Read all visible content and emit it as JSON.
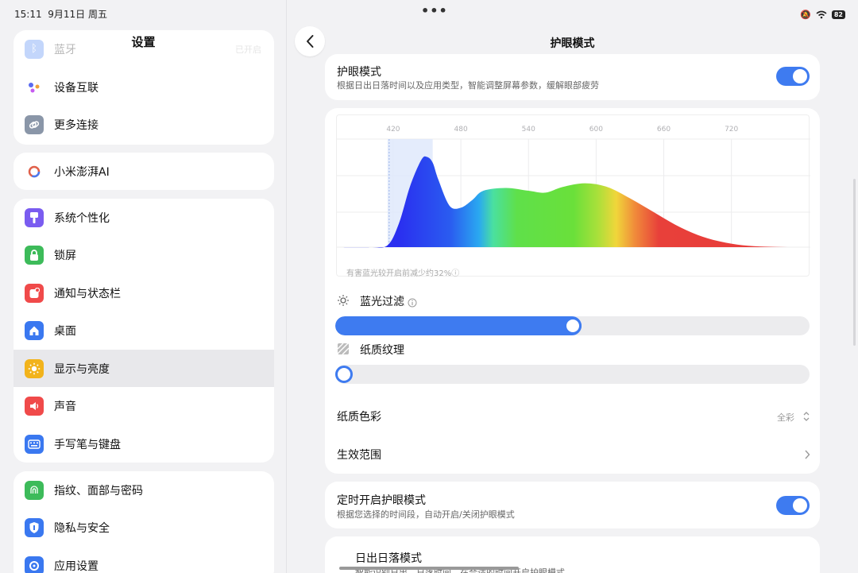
{
  "status": {
    "time": "15:11",
    "date": "9月11日 周五",
    "dots": "•••",
    "battery": "82"
  },
  "left": {
    "title": "设置",
    "bluetooth": {
      "label": "蓝牙",
      "value": "已开启"
    },
    "group1": [
      {
        "label": "设备互联",
        "icon": "device-link-icon"
      },
      {
        "label": "更多连接",
        "icon": "link-icon"
      }
    ],
    "ai": {
      "label": "小米澎湃AI",
      "icon": "hyperos-ai-icon"
    },
    "group2": [
      {
        "label": "系统个性化",
        "icon": "brush-icon",
        "color": "#7a5cf0"
      },
      {
        "label": "锁屏",
        "icon": "lock-icon",
        "color": "#3dbb5a"
      },
      {
        "label": "通知与状态栏",
        "icon": "notification-icon",
        "color": "#f04a4a"
      },
      {
        "label": "桌面",
        "icon": "home-icon",
        "color": "#3a78f0"
      },
      {
        "label": "显示与亮度",
        "icon": "sun-icon",
        "color": "#f2b31b"
      },
      {
        "label": "声音",
        "icon": "speaker-icon",
        "color": "#f04a4a"
      },
      {
        "label": "手写笔与键盘",
        "icon": "keyboard-icon",
        "color": "#3a78f0"
      }
    ],
    "group3": [
      {
        "label": "指纹、面部与密码",
        "icon": "fingerprint-icon",
        "color": "#3dbb5a"
      },
      {
        "label": "隐私与安全",
        "icon": "shield-icon",
        "color": "#3a78f0"
      },
      {
        "label": "应用设置",
        "icon": "app-settings-icon",
        "color": "#3a78f0"
      }
    ]
  },
  "right": {
    "title": "护眼模式",
    "eye_mode": {
      "title": "护眼模式",
      "subtitle": "根据日出日落时间以及应用类型，智能调整屏幕参数，缓解眼部疲劳"
    },
    "chart_note": "有害蓝光较开启前减少约32%ⓘ",
    "blue_filter": {
      "label": "蓝光过滤",
      "level": 0.5
    },
    "paper_texture": {
      "label": "纸质纹理",
      "level": 0.0
    },
    "paper_color": {
      "label": "纸质色彩",
      "value": "全彩"
    },
    "scope": {
      "label": "生效范围"
    },
    "timer": {
      "title": "定时开启护眼模式",
      "subtitle": "根据您选择的时间段，自动开启/关闭护眼模式"
    },
    "sunrise": {
      "title": "日出日落模式",
      "subtitle": "智能识别日出、日落时间，在合适的时间开启护眼模式"
    }
  },
  "chart_data": {
    "type": "area",
    "x_ticks": [
      420,
      480,
      540,
      600,
      660,
      720
    ],
    "xlim": [
      370,
      790
    ],
    "highlight_range": [
      415,
      455
    ],
    "x": [
      370,
      400,
      415,
      425,
      435,
      445,
      450,
      455,
      460,
      470,
      480,
      490,
      500,
      520,
      540,
      555,
      570,
      590,
      610,
      630,
      650,
      670,
      690,
      710,
      730,
      750,
      770,
      790
    ],
    "y": [
      0,
      0,
      0.02,
      0.25,
      0.65,
      0.93,
      0.96,
      0.9,
      0.72,
      0.44,
      0.42,
      0.5,
      0.6,
      0.63,
      0.6,
      0.58,
      0.64,
      0.68,
      0.64,
      0.52,
      0.38,
      0.24,
      0.13,
      0.06,
      0.02,
      0.005,
      0,
      0
    ],
    "ylim": [
      0,
      1.15
    ]
  }
}
